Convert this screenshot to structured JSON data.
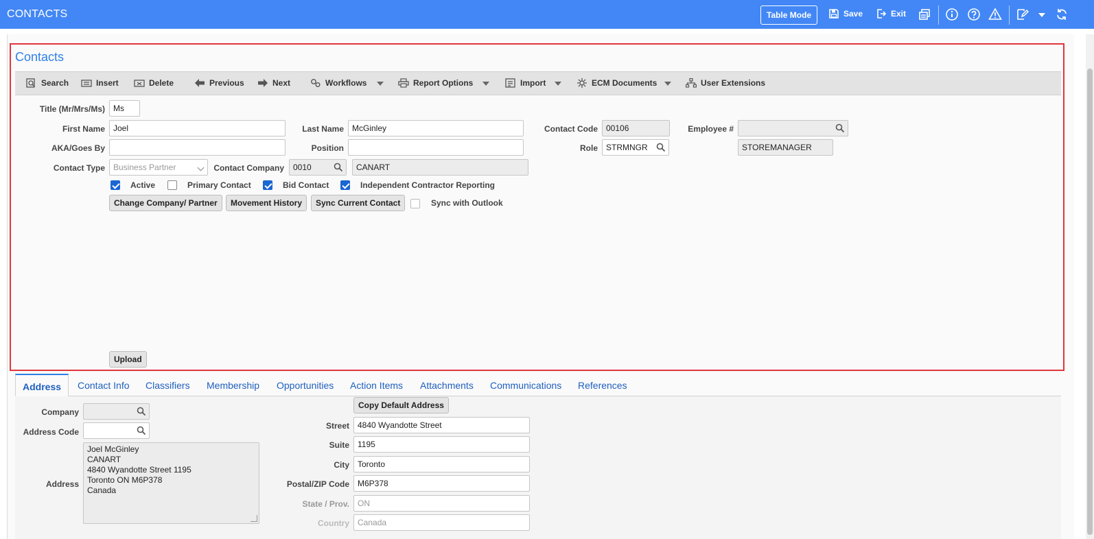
{
  "app": {
    "title": "CONTACTS",
    "table_mode_label": "Table Mode",
    "save_label": "Save",
    "exit_label": "Exit"
  },
  "section": {
    "title": "Contacts"
  },
  "toolbar": {
    "search": "Search",
    "insert": "Insert",
    "delete": "Delete",
    "previous": "Previous",
    "next": "Next",
    "workflows": "Workflows",
    "report_options": "Report Options",
    "import": "Import",
    "ecm_documents": "ECM Documents",
    "user_extensions": "User Extensions"
  },
  "form": {
    "title_label": "Title (Mr/Mrs/Ms)",
    "title_value": "Ms",
    "first_name_label": "First Name",
    "first_name_value": "Joel",
    "last_name_label": "Last Name",
    "last_name_value": "McGinley",
    "contact_code_label": "Contact Code",
    "contact_code_value": "00106",
    "employee_label": "Employee #",
    "employee_value": "",
    "aka_label": "AKA/Goes By",
    "aka_value": "",
    "position_label": "Position",
    "position_value": "",
    "role_label": "Role",
    "role_value": "STRMNGR",
    "role_desc": "STOREMANAGER",
    "contact_type_label": "Contact Type",
    "contact_type_value": "Business Partner",
    "contact_company_label": "Contact Company",
    "contact_company_code": "0010",
    "contact_company_name": "CANART",
    "checkboxes": {
      "active": {
        "label": "Active",
        "checked": true
      },
      "primary_contact": {
        "label": "Primary Contact",
        "checked": false
      },
      "bid_contact": {
        "label": "Bid Contact",
        "checked": true
      },
      "independent_contractor": {
        "label": "Independent Contractor Reporting",
        "checked": true
      },
      "sync_outlook": {
        "label": "Sync with Outlook",
        "checked": false
      }
    },
    "buttons": {
      "change_company": "Change Company/ Partner",
      "movement_history": "Movement History",
      "sync_current": "Sync Current Contact",
      "upload": "Upload"
    }
  },
  "tabs": [
    {
      "label": "Address",
      "active": true
    },
    {
      "label": "Contact Info"
    },
    {
      "label": "Classifiers"
    },
    {
      "label": "Membership"
    },
    {
      "label": "Opportunities"
    },
    {
      "label": "Action Items"
    },
    {
      "label": "Attachments"
    },
    {
      "label": "Communications"
    },
    {
      "label": "References"
    }
  ],
  "address": {
    "company_label": "Company",
    "company_value": "",
    "address_code_label": "Address Code",
    "address_code_value": "",
    "address_label": "Address",
    "address_lines": [
      "Joel McGinley",
      "CANART",
      "4840 Wyandotte Street 1195",
      "Toronto ON M6P378",
      "Canada"
    ],
    "copy_default_label": "Copy Default Address",
    "street_label": "Street",
    "street_value": "4840 Wyandotte Street",
    "suite_label": "Suite",
    "suite_value": "1195",
    "city_label": "City",
    "city_value": "Toronto",
    "postal_label": "Postal/ZIP Code",
    "postal_value": "M6P378",
    "state_label": "State / Prov.",
    "state_value": "ON",
    "country_label": "Country",
    "country_value": "Canada"
  },
  "colors": {
    "topbar": "#4287f5",
    "accent": "#2e7fe8",
    "highlight_border": "#e0353b",
    "checkbox": "#1a66d2"
  }
}
